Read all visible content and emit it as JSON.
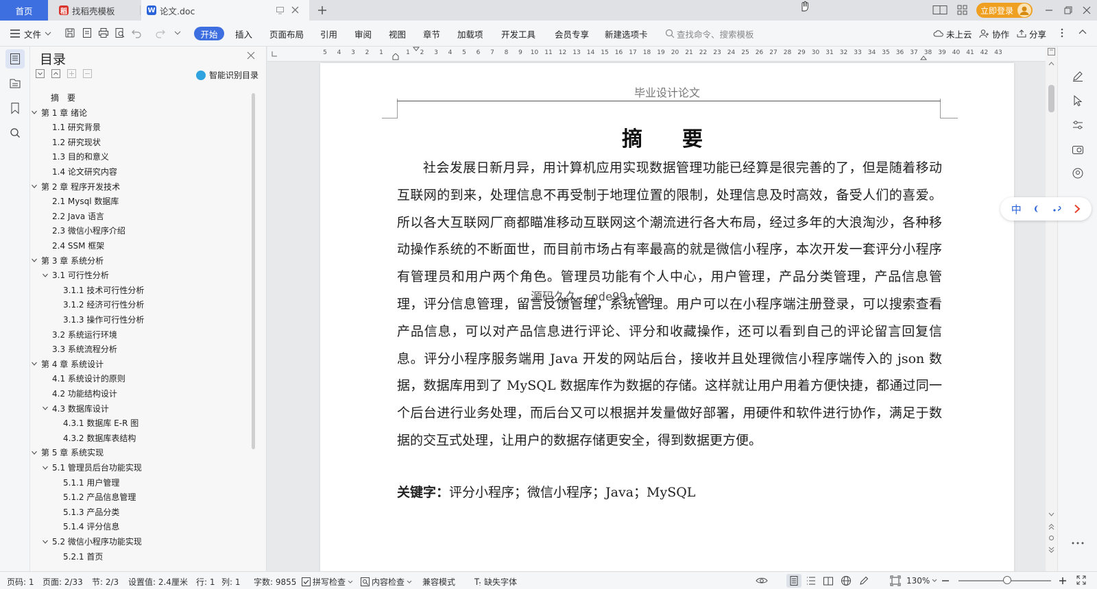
{
  "tabs": {
    "home": "首页",
    "template": "找稻壳模板",
    "document": "论文.doc",
    "login": "立即登录"
  },
  "ribbon": {
    "file": "文件",
    "tabs": [
      "开始",
      "插入",
      "页面布局",
      "引用",
      "审阅",
      "视图",
      "章节",
      "加载项",
      "开发工具",
      "会员专享",
      "新建选项卡"
    ],
    "search_placeholder": "查找命令、搜索模板",
    "cloud": "未上云",
    "collab": "协作",
    "share": "分享"
  },
  "toc": {
    "title": "目录",
    "smart": "智能识别目录",
    "items": [
      {
        "label": "摘　要",
        "level": 0,
        "chev": "none"
      },
      {
        "label": "第 1 章  绪论",
        "level": 0,
        "chev": "down"
      },
      {
        "label": "1.1  研究背景",
        "level": 1,
        "chev": "none"
      },
      {
        "label": "1.2  研究现状",
        "level": 1,
        "chev": "none"
      },
      {
        "label": "1.3  目的和意义",
        "level": 1,
        "chev": "none"
      },
      {
        "label": "1.4  论文研究内容",
        "level": 1,
        "chev": "none"
      },
      {
        "label": "第 2 章  程序开发技术",
        "level": 0,
        "chev": "down"
      },
      {
        "label": "2.1 Mysql 数据库",
        "level": 1,
        "chev": "none"
      },
      {
        "label": "2.2 Java 语言",
        "level": 1,
        "chev": "none"
      },
      {
        "label": "2.3  微信小程序介绍",
        "level": 1,
        "chev": "none"
      },
      {
        "label": "2.4 SSM 框架",
        "level": 1,
        "chev": "none"
      },
      {
        "label": "第 3 章  系统分析",
        "level": 0,
        "chev": "down"
      },
      {
        "label": "3.1 可行性分析",
        "level": 1,
        "chev": "down"
      },
      {
        "label": "3.1.1 技术可行性分析",
        "level": 2,
        "chev": "none"
      },
      {
        "label": "3.1.2 经济可行性分析",
        "level": 2,
        "chev": "none"
      },
      {
        "label": "3.1.3 操作可行性分析",
        "level": 2,
        "chev": "none"
      },
      {
        "label": "3.2 系统运行环境",
        "level": 1,
        "chev": "none"
      },
      {
        "label": "3.3 系统流程分析",
        "level": 1,
        "chev": "none"
      },
      {
        "label": "第 4 章  系统设计",
        "level": 0,
        "chev": "down"
      },
      {
        "label": "4.1  系统设计的原则",
        "level": 1,
        "chev": "none"
      },
      {
        "label": "4.2  功能结构设计",
        "level": 1,
        "chev": "none"
      },
      {
        "label": "4.3  数据库设计",
        "level": 1,
        "chev": "down"
      },
      {
        "label": "4.3.1  数据库 E-R 图",
        "level": 2,
        "chev": "none"
      },
      {
        "label": "4.3.2  数据库表结构",
        "level": 2,
        "chev": "none"
      },
      {
        "label": "第 5 章  系统实现",
        "level": 0,
        "chev": "down"
      },
      {
        "label": "5.1 管理员后台功能实现",
        "level": 1,
        "chev": "down"
      },
      {
        "label": "5.1.1  用户管理",
        "level": 2,
        "chev": "none"
      },
      {
        "label": "5.1.2  产品信息管理",
        "level": 2,
        "chev": "none"
      },
      {
        "label": "5.1.3  产品分类",
        "level": 2,
        "chev": "none"
      },
      {
        "label": "5.1.4  评分信息",
        "level": 2,
        "chev": "none"
      },
      {
        "label": "5.2  微信小程序功能实现",
        "level": 1,
        "chev": "down"
      },
      {
        "label": "5.2.1  首页",
        "level": 2,
        "chev": "none"
      }
    ]
  },
  "ruler": [
    "5",
    "4",
    "3",
    "2",
    "1",
    "1",
    "2",
    "3",
    "4",
    "5",
    "6",
    "7",
    "8",
    "9",
    "10",
    "11",
    "12",
    "13",
    "14",
    "15",
    "16",
    "17",
    "18",
    "19",
    "20",
    "21",
    "22",
    "23",
    "24",
    "25",
    "26",
    "27",
    "28",
    "29",
    "30",
    "31",
    "32",
    "33",
    "34",
    "35",
    "36",
    "37",
    "38",
    "39",
    "40",
    "41",
    "42",
    "43"
  ],
  "document": {
    "header": "毕业设计论文",
    "title": "摘　要",
    "body": "社会发展日新月异，用计算机应用实现数据管理功能已经算是很完善的了，但是随着移动互联网的到来，处理信息不再受制于地理位置的限制，处理信息及时高效，备受人们的喜爱。所以各大互联网厂商都瞄准移动互联网这个潮流进行各大布局，经过多年的大浪淘沙，各种移动操作系统的不断面世，而目前市场占有率最高的就是微信小程序，本次开发一套评分小程序有管理员和用户两个角色。管理员功能有个人中心，用户管理，产品分类管理，产品信息管理，评分信息管理，留言反馈管理，系统管理。用户可以在小程序端注册登录，可以搜索查看产品信息，可以对产品信息进行评论、评分和收藏操作，还可以看到自己的评论留言回复信息。评分小程序服务端用 Java 开发的网站后台，接收并且处理微信小程序端传入的 json 数据，数据库用到了 MySQL 数据库作为数据的存储。这样就让用户用着方便快捷，都通过同一个后台进行业务处理，而后台又可以根据并发量做好部署，用硬件和软件进行协作，满足于数据的交互式处理，让用户的数据存储更安全，得到数据更方便。",
    "keywords_label": "关键字：",
    "keywords": "评分小程序；微信小程序；Java；MySQL",
    "watermark": "源码久久-code99.top"
  },
  "ime": {
    "lang": "中"
  },
  "status": {
    "page": "页码: 1",
    "pages": "页面: 2/33",
    "section": "节: 2/3",
    "setting": "设置值: 2.4厘米",
    "row": "行: 1",
    "col": "列: 1",
    "words": "字数: 9855",
    "spell": "拼写检查",
    "content": "内容检查",
    "compat": "兼容模式",
    "font": "缺失字体",
    "zoom": "130%"
  },
  "colors": {
    "accent": "#3d6fe0",
    "login": "#f0a020"
  }
}
